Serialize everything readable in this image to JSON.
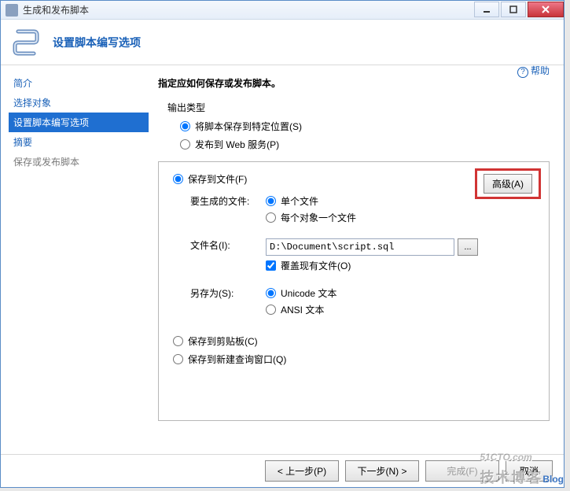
{
  "window": {
    "title": "生成和发布脚本"
  },
  "header": {
    "title": "设置脚本编写选项"
  },
  "sidebar": {
    "items": [
      {
        "label": "简介",
        "name": "sidebar-item-intro"
      },
      {
        "label": "选择对象",
        "name": "sidebar-item-choose"
      },
      {
        "label": "设置脚本编写选项",
        "name": "sidebar-item-options"
      },
      {
        "label": "摘要",
        "name": "sidebar-item-summary"
      },
      {
        "label": "保存或发布脚本",
        "name": "sidebar-item-save"
      }
    ]
  },
  "help": {
    "label": "帮助"
  },
  "main": {
    "heading": "指定应如何保存或发布脚本。",
    "output_type_label": "输出类型",
    "radio_save_location": "将脚本保存到特定位置(S)",
    "radio_publish_web": "发布到 Web 服务(P)",
    "advanced_btn": "高级(A)",
    "radio_save_file": "保存到文件(F)",
    "files_to_generate_label": "要生成的文件:",
    "radio_single_file": "单个文件",
    "radio_file_per_object": "每个对象一个文件",
    "filename_label": "文件名(I):",
    "filename_value": "D:\\Document\\script.sql",
    "overwrite_label": "覆盖现有文件(O)",
    "save_as_label": "另存为(S):",
    "radio_unicode": "Unicode 文本",
    "radio_ansi": "ANSI 文本",
    "radio_clipboard": "保存到剪贴板(C)",
    "radio_new_query": "保存到新建查询窗口(Q)"
  },
  "footer": {
    "back": "< 上一步(P)",
    "next": "下一步(N) >",
    "finish": "完成(F)",
    "cancel": "取消"
  },
  "watermark": {
    "domain": "51CTO.com",
    "cn": "技术博客",
    "blog": "Blog"
  }
}
